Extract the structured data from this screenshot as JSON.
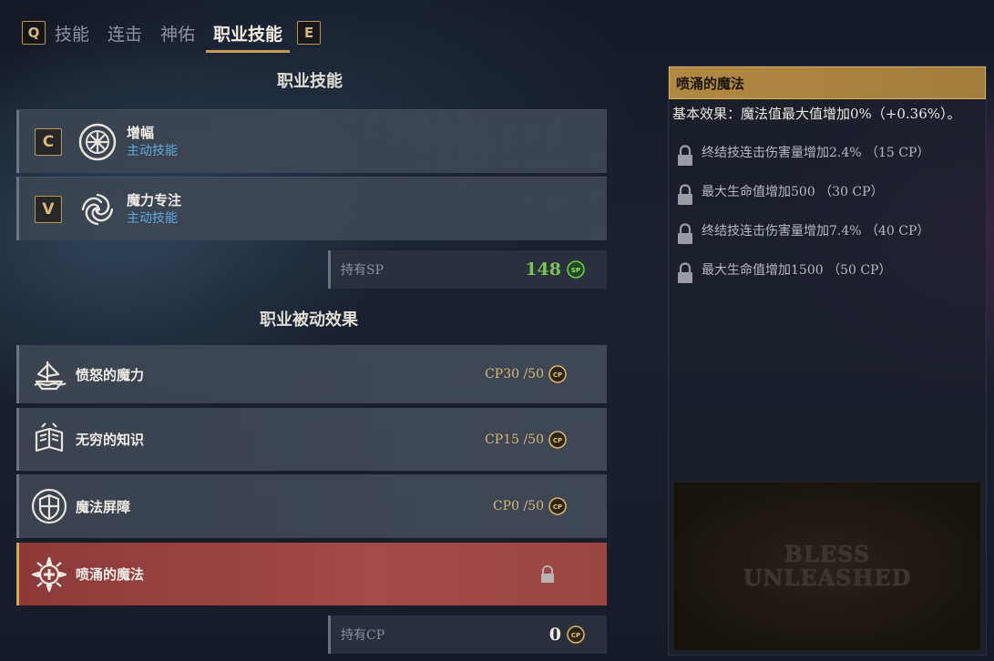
{
  "tabs": {
    "left_key": "Q",
    "items": [
      {
        "label": "技能",
        "active": false
      },
      {
        "label": "连击",
        "active": false
      },
      {
        "label": "神佑",
        "active": false
      },
      {
        "label": "职业技能",
        "active": true
      }
    ],
    "right_key": "E"
  },
  "job_skills": {
    "title": "职业技能",
    "items": [
      {
        "key": "C",
        "name": "增幅",
        "type": "主动技能",
        "icon": "starburst-emblem-icon"
      },
      {
        "key": "V",
        "name": "魔力专注",
        "type": "主动技能",
        "icon": "swirl-emblem-icon"
      }
    ],
    "sp": {
      "label": "持有SP",
      "value": "148",
      "coin": "SP",
      "color": "#7ac257"
    }
  },
  "passives": {
    "title": "职业被动效果",
    "items": [
      {
        "name": "愤怒的魔力",
        "cp": "CP30 /50",
        "coin": "CP",
        "icon": "ship-emblem-icon",
        "selected": false
      },
      {
        "name": "无穷的知识",
        "cp": "CP15 /50",
        "coin": "CP",
        "icon": "book-emblem-icon",
        "selected": false
      },
      {
        "name": "魔法屏障",
        "cp": "CP0 /50",
        "coin": "CP",
        "icon": "shield-emblem-icon",
        "selected": false
      },
      {
        "name": "喷涌的魔法",
        "cp": "",
        "coin": "",
        "icon": "cross-emblem-icon",
        "selected": true,
        "locked": true
      }
    ],
    "cp": {
      "label": "持有CP",
      "value": "0",
      "coin": "CP"
    }
  },
  "detail": {
    "title": "喷涌的魔法",
    "base_effect": "基本效果：魔法值最大值增加0%（+0.36%）。",
    "effects": [
      {
        "text": "终结技连击伤害量增加2.4% （15 CP）",
        "locked": true
      },
      {
        "text": "最大生命值增加500 （30 CP）",
        "locked": true
      },
      {
        "text": "终结技连击伤害量增加7.4% （40 CP）",
        "locked": true
      },
      {
        "text": "最大生命值增加1500 （50 CP）",
        "locked": true
      }
    ],
    "banner": {
      "line1": "BLESS",
      "line2": "UNLEASHED"
    }
  },
  "colors": {
    "accent_gold": "#c79d55",
    "skill_type_blue": "#5fa8de",
    "selected_red": "#9a4744",
    "sp_green": "#7ac257"
  }
}
